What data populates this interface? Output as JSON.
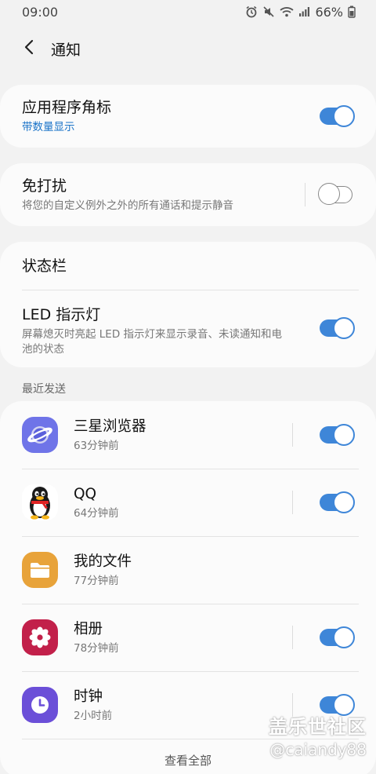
{
  "status_bar": {
    "time": "09:00",
    "battery": "66%"
  },
  "header": {
    "title": "通知"
  },
  "badges": {
    "title": "应用程序角标",
    "subtitle": "带数量显示",
    "enabled": true
  },
  "dnd": {
    "title": "免打扰",
    "subtitle": "将您的自定义例外之外的所有通话和提示静音",
    "enabled": false
  },
  "status_section": {
    "title": "状态栏",
    "led": {
      "title": "LED 指示灯",
      "subtitle": "屏幕熄灭时亮起 LED 指示灯来显示录音、未读通知和电池的状态",
      "enabled": true
    }
  },
  "recent": {
    "header": "最近发送",
    "apps": [
      {
        "name": "三星浏览器",
        "time": "63分钟前",
        "icon": "samsung-internet-icon",
        "color": "#6f74e8",
        "toggle": true
      },
      {
        "name": "QQ",
        "time": "64分钟前",
        "icon": "qq-penguin-icon",
        "color": "#ffffff",
        "toggle": true
      },
      {
        "name": "我的文件",
        "time": "77分钟前",
        "icon": "folder-icon",
        "color": "#e8a33a",
        "toggle": false
      },
      {
        "name": "相册",
        "time": "78分钟前",
        "icon": "flower-icon",
        "color": "#c2204a",
        "toggle": true
      },
      {
        "name": "时钟",
        "time": "2小时前",
        "icon": "clock-icon",
        "color": "#6b4fd8",
        "toggle": true
      }
    ],
    "view_all": "查看全部"
  },
  "watermark": {
    "line1": "盖乐世社区",
    "line2": "@caiandy88"
  },
  "colors": {
    "accent": "#3e86d8",
    "link": "#1a73c8",
    "background": "#f2f2f2",
    "card": "#fbfbfb"
  }
}
